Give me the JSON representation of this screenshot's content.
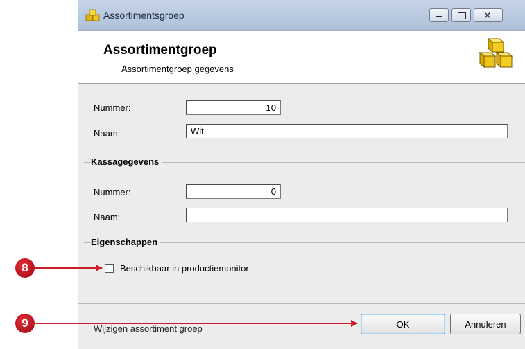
{
  "window": {
    "title": "Assortimentsgroep",
    "controls": {
      "minimize": "minimize",
      "maximize": "maximize",
      "close": "close"
    }
  },
  "header": {
    "title": "Assortimentgroep",
    "subtitle": "Assortimentgroep gegevens"
  },
  "form": {
    "nummer_label": "Nummer:",
    "nummer_value": "10",
    "naam_label": "Naam:",
    "naam_value": "Wit"
  },
  "kassa": {
    "section_title": "Kassagegevens",
    "nummer_label": "Nummer:",
    "nummer_value": "0",
    "naam_label": "Naam:",
    "naam_value": ""
  },
  "eigenschappen": {
    "section_title": "Eigenschappen",
    "checkbox_label": "Beschikbaar in productiemonitor",
    "checked": false
  },
  "footer": {
    "status": "Wijzigen assortiment groep",
    "ok_label": "OK",
    "cancel_label": "Annuleren"
  },
  "callouts": [
    {
      "label": "8",
      "target": "checkbox-beschikbaar"
    },
    {
      "label": "9",
      "target": "ok-button"
    }
  ],
  "colors": {
    "callout": "#c81e28",
    "titlebar": "#b7c8df",
    "icon_gold": "#e8c21a"
  }
}
